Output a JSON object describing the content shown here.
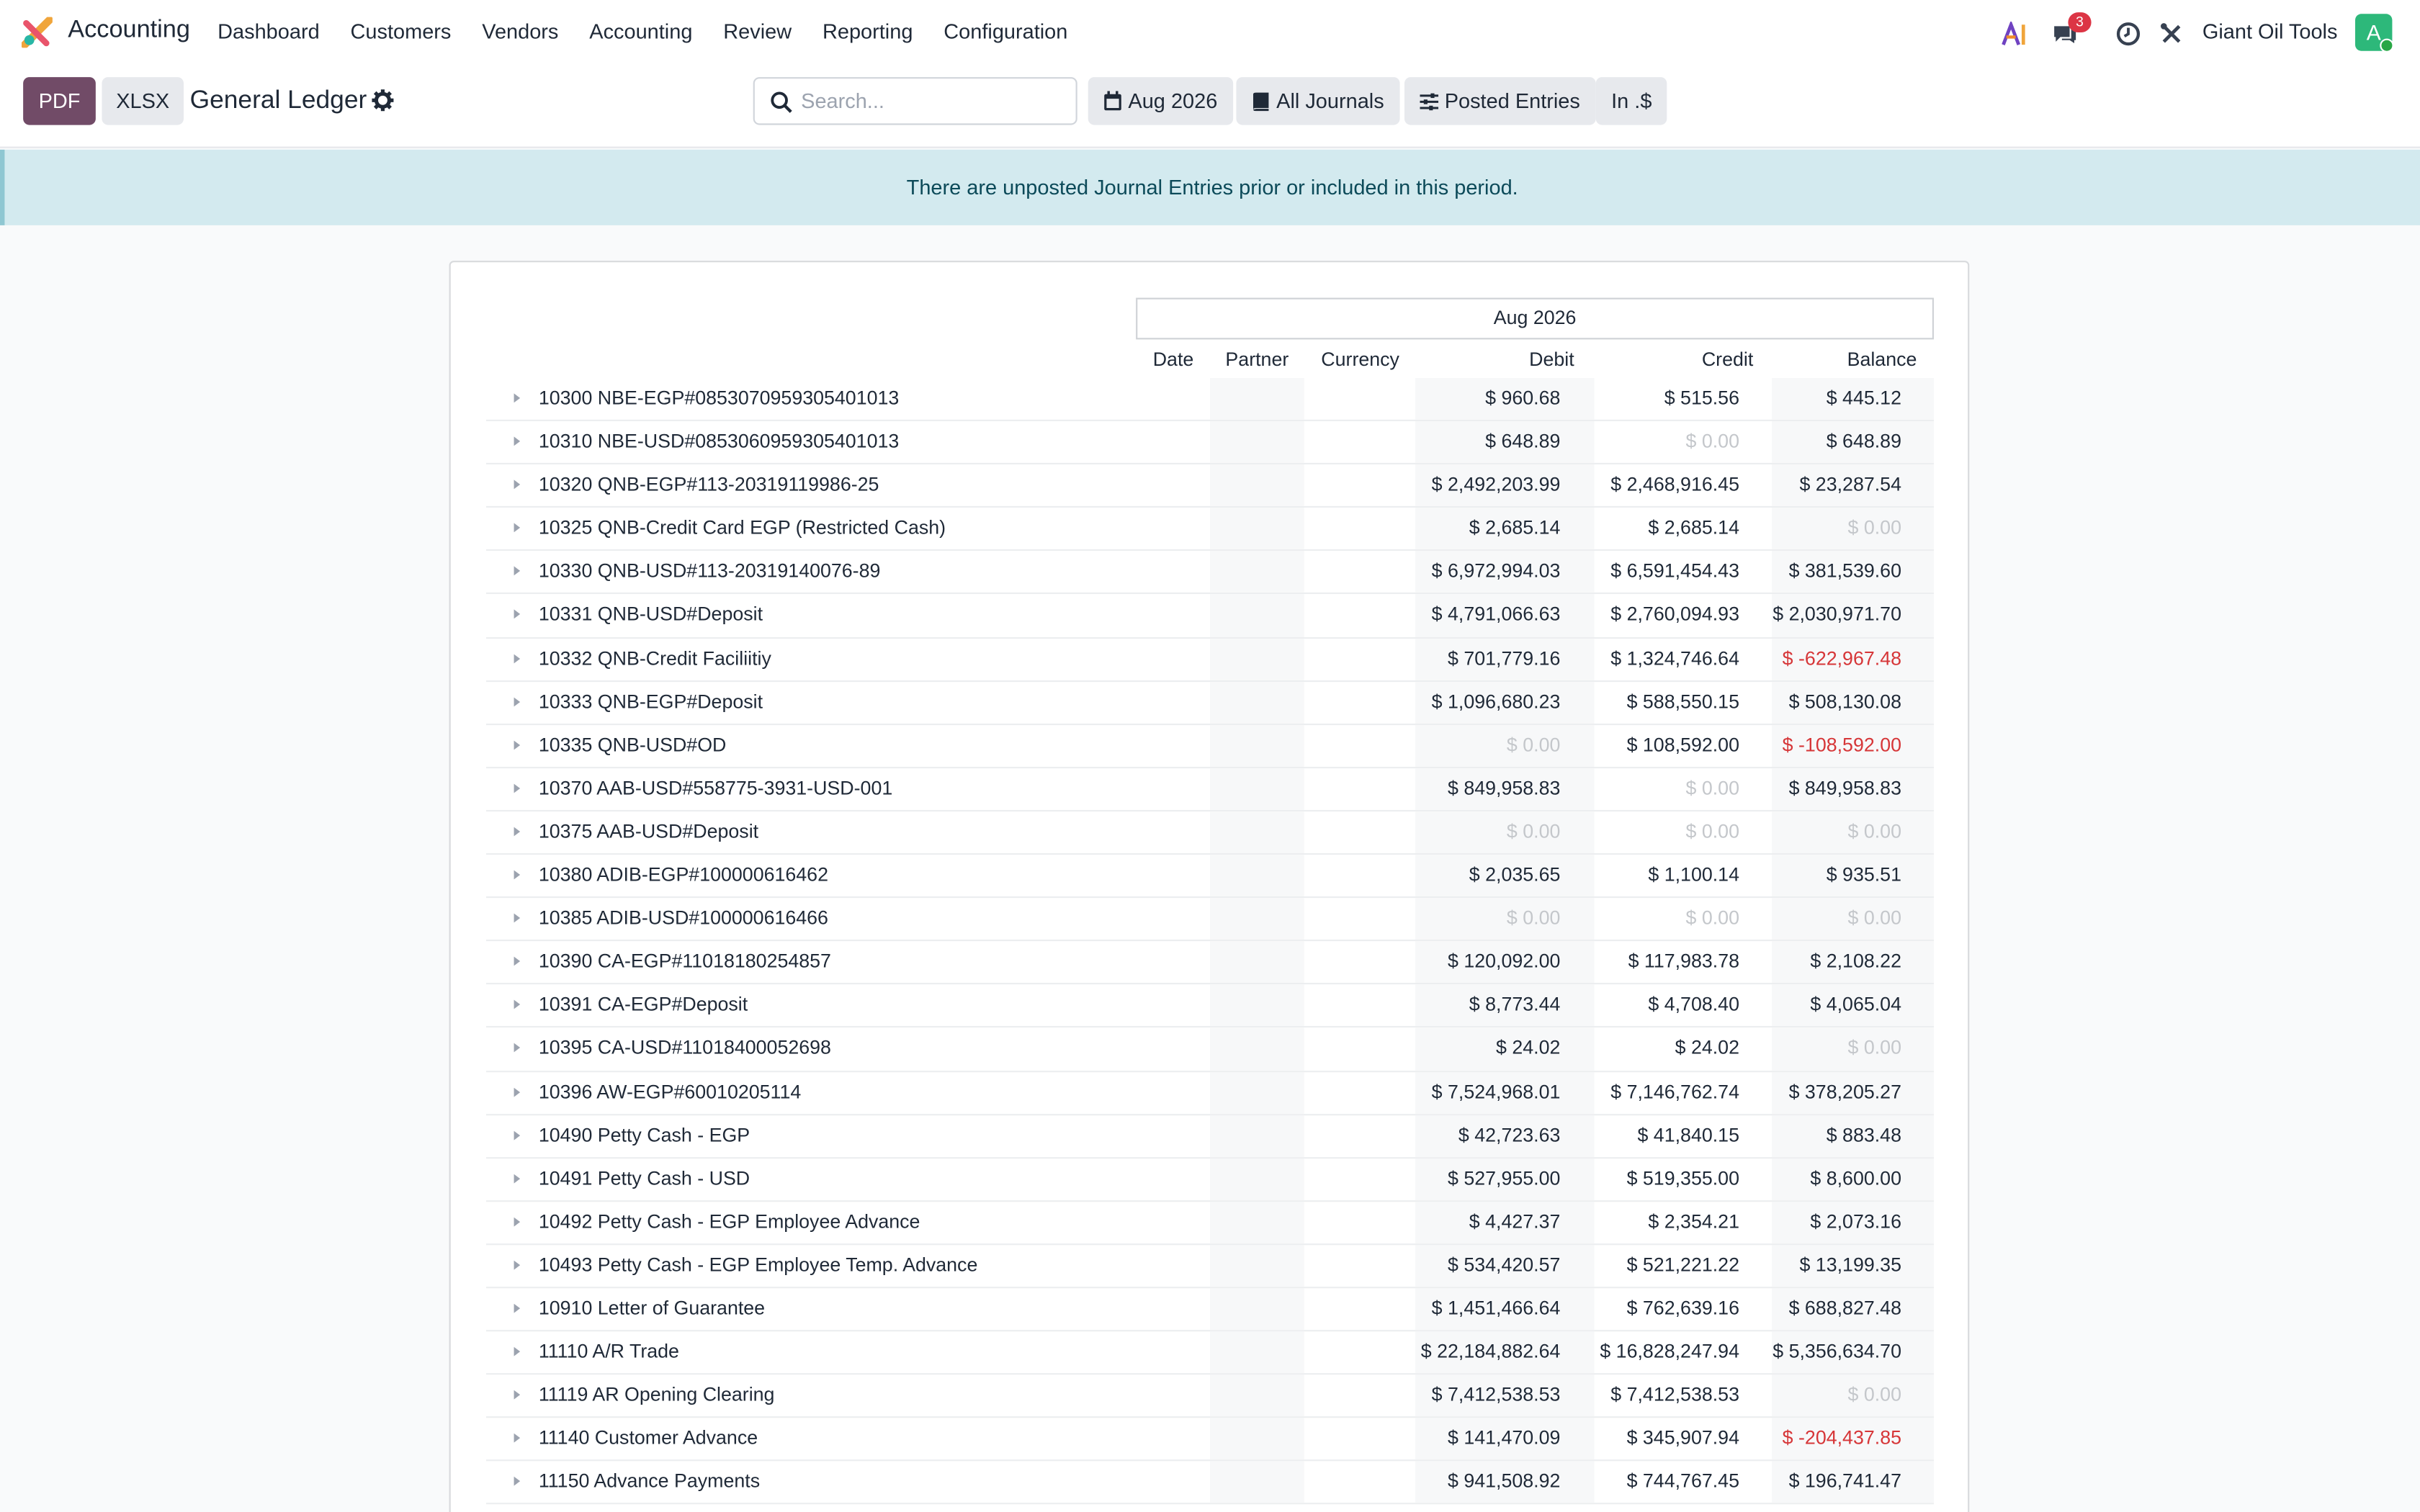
{
  "nav": {
    "app_name": "Accounting",
    "menu": [
      "Dashboard",
      "Customers",
      "Vendors",
      "Accounting",
      "Review",
      "Reporting",
      "Configuration"
    ],
    "messages_badge": "3",
    "company": "Giant Oil Tools",
    "avatar_letter": "A",
    "icons": [
      "ai-icon",
      "chat-icon",
      "clock-icon",
      "tools-icon"
    ]
  },
  "control": {
    "pdf_label": "PDF",
    "xlsx_label": "XLSX",
    "title": "General Ledger",
    "search_placeholder": "Search...",
    "filters": {
      "date": "Aug 2026",
      "journals": "All Journals",
      "entries": "Posted Entries",
      "currency": "In .$"
    }
  },
  "alert": "There are unposted Journal Entries prior or included in this period.",
  "report": {
    "period": "Aug 2026",
    "columns": [
      "Date",
      "Partner",
      "Currency",
      "Debit",
      "Credit",
      "Balance"
    ],
    "rows": [
      {
        "name": "10300 NBE-EGP#0853070959305401013",
        "debit": "$ 960.68",
        "credit": "$ 515.56",
        "balance": "$ 445.12"
      },
      {
        "name": "10310 NBE-USD#0853060959305401013",
        "debit": "$ 648.89",
        "credit": "$ 0.00",
        "balance": "$ 648.89"
      },
      {
        "name": "10320 QNB-EGP#113-20319119986-25",
        "debit": "$ 2,492,203.99",
        "credit": "$ 2,468,916.45",
        "balance": "$ 23,287.54"
      },
      {
        "name": "10325 QNB-Credit Card EGP (Restricted Cash)",
        "debit": "$ 2,685.14",
        "credit": "$ 2,685.14",
        "balance": "$ 0.00"
      },
      {
        "name": "10330 QNB-USD#113-20319140076-89",
        "debit": "$ 6,972,994.03",
        "credit": "$ 6,591,454.43",
        "balance": "$ 381,539.60"
      },
      {
        "name": "10331 QNB-USD#Deposit",
        "debit": "$ 4,791,066.63",
        "credit": "$ 2,760,094.93",
        "balance": "$ 2,030,971.70"
      },
      {
        "name": "10332 QNB-Credit Faciliitiy",
        "debit": "$ 701,779.16",
        "credit": "$ 1,324,746.64",
        "balance": "$ -622,967.48"
      },
      {
        "name": "10333 QNB-EGP#Deposit",
        "debit": "$ 1,096,680.23",
        "credit": "$ 588,550.15",
        "balance": "$ 508,130.08"
      },
      {
        "name": "10335 QNB-USD#OD",
        "debit": "$ 0.00",
        "credit": "$ 108,592.00",
        "balance": "$ -108,592.00"
      },
      {
        "name": "10370 AAB-USD#558775-3931-USD-001",
        "debit": "$ 849,958.83",
        "credit": "$ 0.00",
        "balance": "$ 849,958.83"
      },
      {
        "name": "10375 AAB-USD#Deposit",
        "debit": "$ 0.00",
        "credit": "$ 0.00",
        "balance": "$ 0.00"
      },
      {
        "name": "10380 ADIB-EGP#100000616462",
        "debit": "$ 2,035.65",
        "credit": "$ 1,100.14",
        "balance": "$ 935.51"
      },
      {
        "name": "10385 ADIB-USD#100000616466",
        "debit": "$ 0.00",
        "credit": "$ 0.00",
        "balance": "$ 0.00"
      },
      {
        "name": "10390 CA-EGP#11018180254857",
        "debit": "$ 120,092.00",
        "credit": "$ 117,983.78",
        "balance": "$ 2,108.22"
      },
      {
        "name": "10391 CA-EGP#Deposit",
        "debit": "$ 8,773.44",
        "credit": "$ 4,708.40",
        "balance": "$ 4,065.04"
      },
      {
        "name": "10395 CA-USD#11018400052698",
        "debit": "$ 24.02",
        "credit": "$ 24.02",
        "balance": "$ 0.00"
      },
      {
        "name": "10396 AW-EGP#60010205114",
        "debit": "$ 7,524,968.01",
        "credit": "$ 7,146,762.74",
        "balance": "$ 378,205.27"
      },
      {
        "name": "10490 Petty Cash - EGP",
        "debit": "$ 42,723.63",
        "credit": "$ 41,840.15",
        "balance": "$ 883.48"
      },
      {
        "name": "10491 Petty Cash - USD",
        "debit": "$ 527,955.00",
        "credit": "$ 519,355.00",
        "balance": "$ 8,600.00"
      },
      {
        "name": "10492 Petty Cash - EGP Employee Advance",
        "debit": "$ 4,427.37",
        "credit": "$ 2,354.21",
        "balance": "$ 2,073.16"
      },
      {
        "name": "10493 Petty Cash - EGP Employee Temp. Advance",
        "debit": "$ 534,420.57",
        "credit": "$ 521,221.22",
        "balance": "$ 13,199.35"
      },
      {
        "name": "10910 Letter of Guarantee",
        "debit": "$ 1,451,466.64",
        "credit": "$ 762,639.16",
        "balance": "$ 688,827.48"
      },
      {
        "name": "11110 A/R Trade",
        "debit": "$ 22,184,882.64",
        "credit": "$ 16,828,247.94",
        "balance": "$ 5,356,634.70"
      },
      {
        "name": "11119 AR Opening Clearing",
        "debit": "$ 7,412,538.53",
        "credit": "$ 7,412,538.53",
        "balance": "$ 0.00"
      },
      {
        "name": "11140 Customer Advance",
        "debit": "$ 141,470.09",
        "credit": "$ 345,907.94",
        "balance": "$ -204,437.85"
      },
      {
        "name": "11150 Advance Payments",
        "debit": "$ 941,508.92",
        "credit": "$ 744,767.45",
        "balance": "$ 196,741.47"
      }
    ]
  },
  "colors": {
    "brand": "#714b67",
    "alert_bg": "#d3eaef",
    "negative": "#d63638",
    "zero": "#c4c7cb"
  }
}
